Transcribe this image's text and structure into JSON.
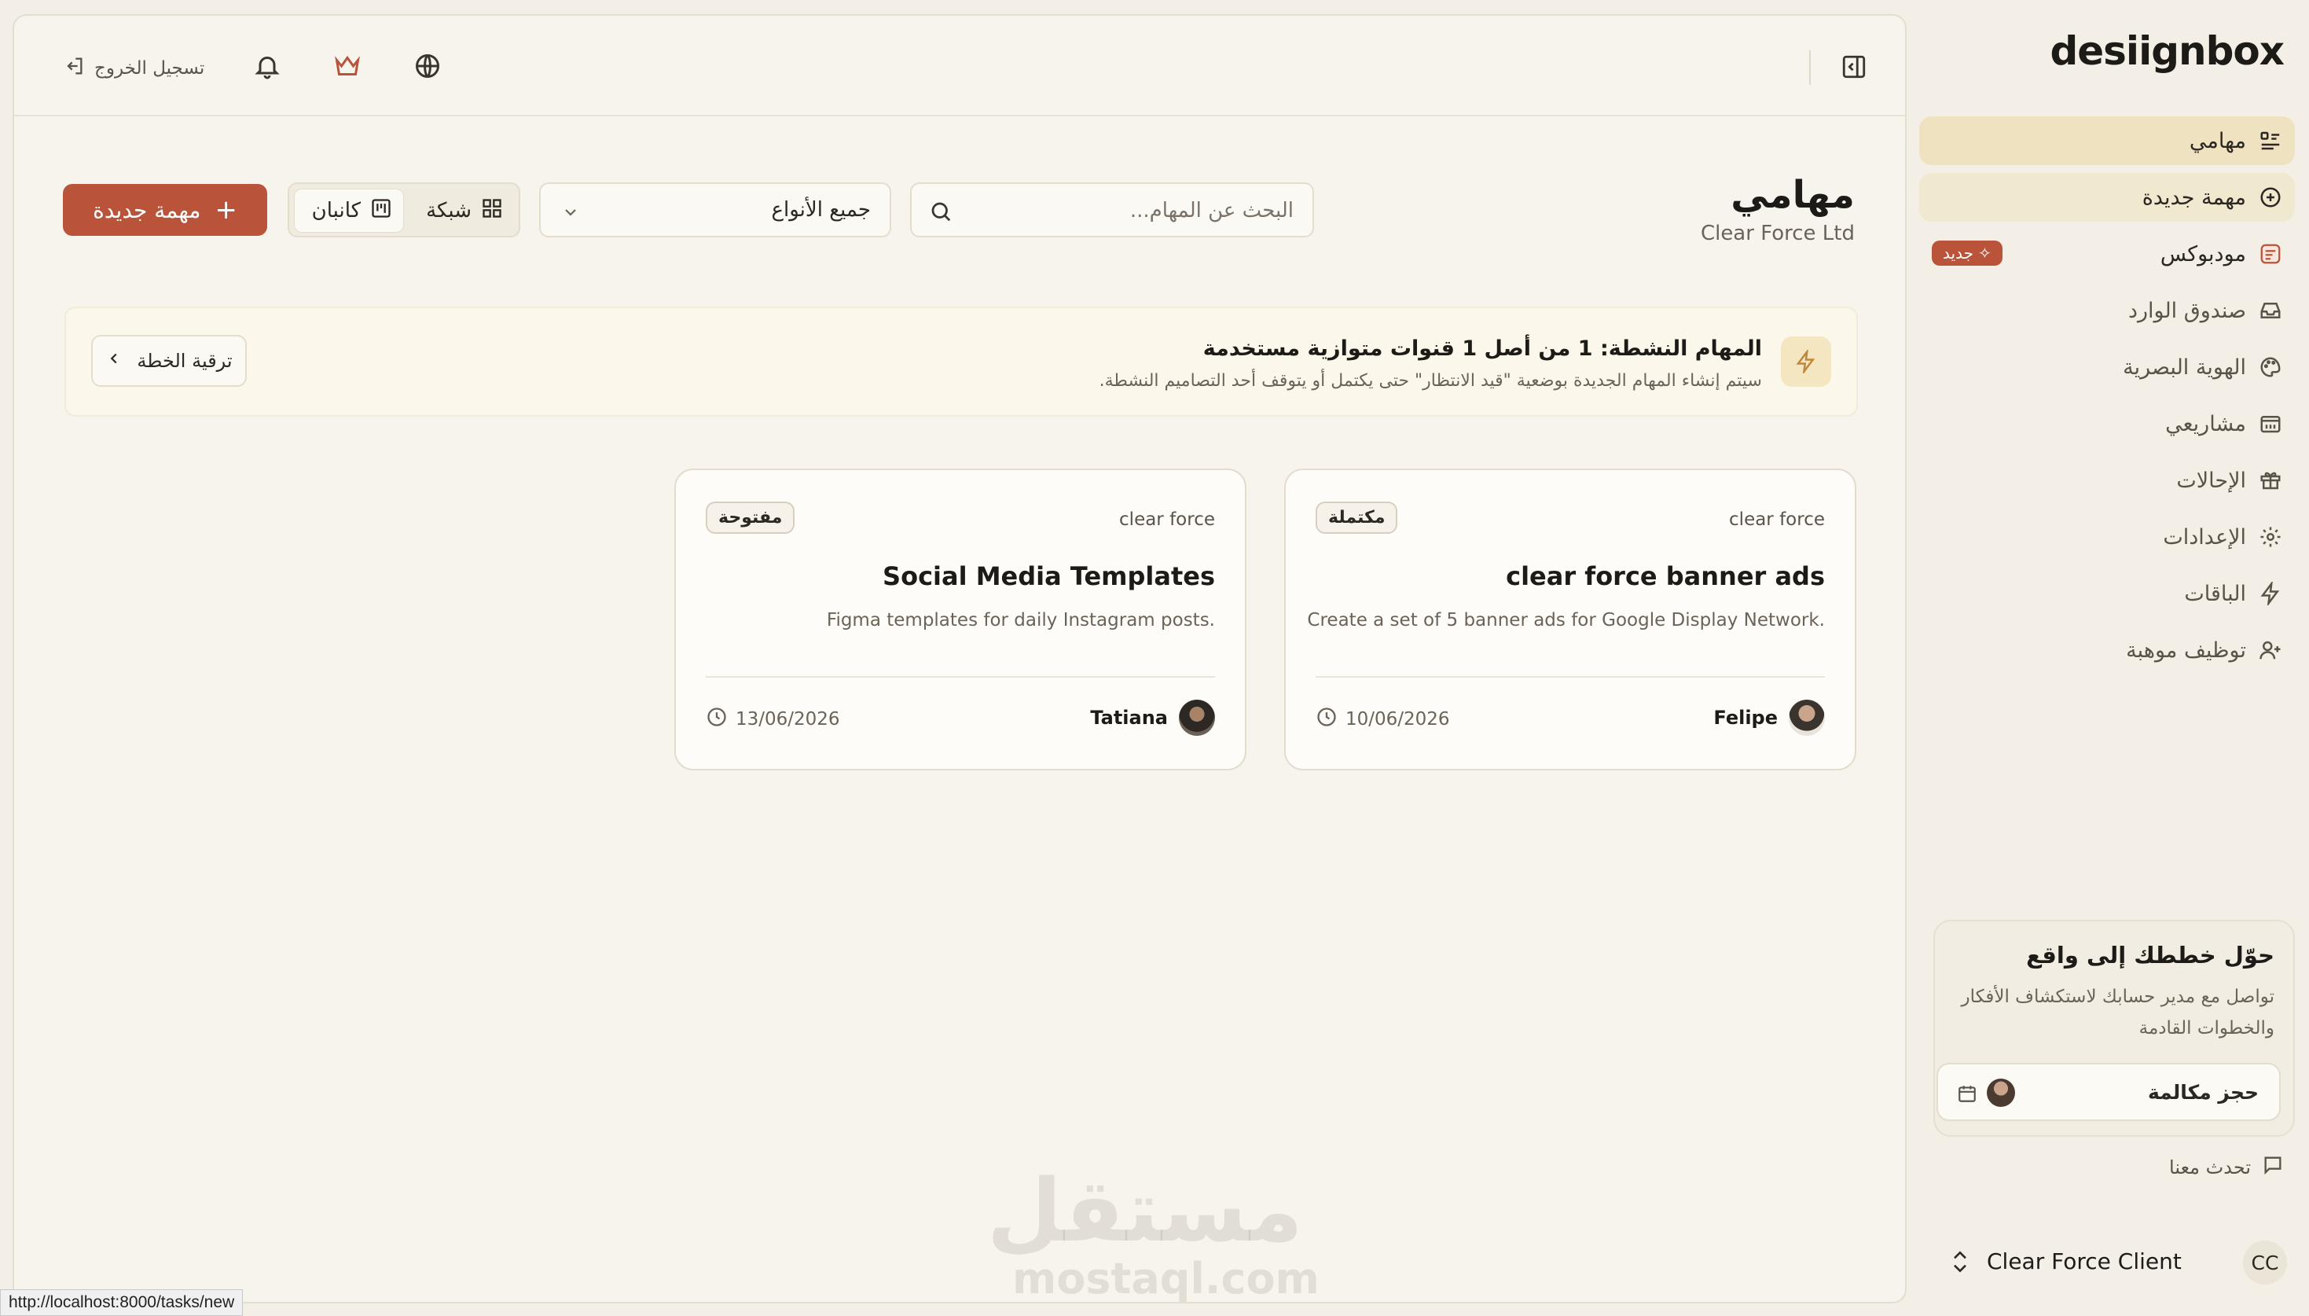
{
  "brand": {
    "logo": "desiignbox"
  },
  "sidebar": {
    "items": [
      {
        "label": "مهامي",
        "icon": "tasks-list-icon"
      },
      {
        "label": "مهمة جديدة",
        "icon": "plus-circle-icon"
      },
      {
        "label": "مودبوكس",
        "icon": "moodbox-icon",
        "badge": "جديد"
      },
      {
        "label": "صندوق الوارد",
        "icon": "inbox-icon"
      },
      {
        "label": "الهوية البصرية",
        "icon": "palette-icon"
      },
      {
        "label": "مشاريعي",
        "icon": "calendar-projects-icon"
      },
      {
        "label": "الإحالات",
        "icon": "gift-icon"
      },
      {
        "label": "الإعدادات",
        "icon": "gear-icon"
      },
      {
        "label": "الباقات",
        "icon": "bolt-icon"
      },
      {
        "label": "توظيف موهبة",
        "icon": "user-plus-icon"
      }
    ],
    "promo": {
      "title": "حوّل خططك إلى واقع",
      "text": "تواصل مع مدير حسابك لاستكشاف الأفكار والخطوات القادمة",
      "button": "حجز مكالمة"
    },
    "chat": "تحدث معنا",
    "client": {
      "initials": "CC",
      "name": "Clear Force Client"
    }
  },
  "topbar": {
    "logout": "تسجيل الخروج",
    "icons": [
      "bell-icon",
      "crown-icon",
      "globe-icon",
      "sidebar-toggle-icon"
    ]
  },
  "page": {
    "title": "مهامي",
    "subtitle": "Clear Force Ltd",
    "search_placeholder": "البحث عن المهام...",
    "type_filter": "جميع الأنواع",
    "view_grid": "شبكة",
    "view_kanban": "كانبان",
    "new_task": "مهمة جديدة"
  },
  "alert": {
    "title": "المهام النشطة: 1 من أصل 1 قنوات متوازية مستخدمة",
    "desc": "سيتم إنشاء المهام الجديدة بوضعية \"قيد الانتظار\" حتى يكتمل أو يتوقف أحد التصاميم النشطة.",
    "button": "ترقية الخطة"
  },
  "tasks": [
    {
      "client": "clear force",
      "status": "مكتملة",
      "title": "clear force banner ads",
      "desc": "Create a set of 5 banner ads for Google Display Network.",
      "assignee": "Felipe",
      "due": "10/06/2026"
    },
    {
      "client": "clear force",
      "status": "مفتوحة",
      "title": "Social Media Templates",
      "desc": "Figma templates for daily Instagram posts.",
      "assignee": "Tatiana",
      "due": "13/06/2026"
    }
  ],
  "watermark": {
    "arabic": "مستقل",
    "latin": "mostaql.com"
  },
  "status_url": "http://localhost:8000/tasks/new",
  "colors": {
    "accent": "#b9543a",
    "active_nav": "#efe2c0",
    "background": "#f3efe6"
  }
}
